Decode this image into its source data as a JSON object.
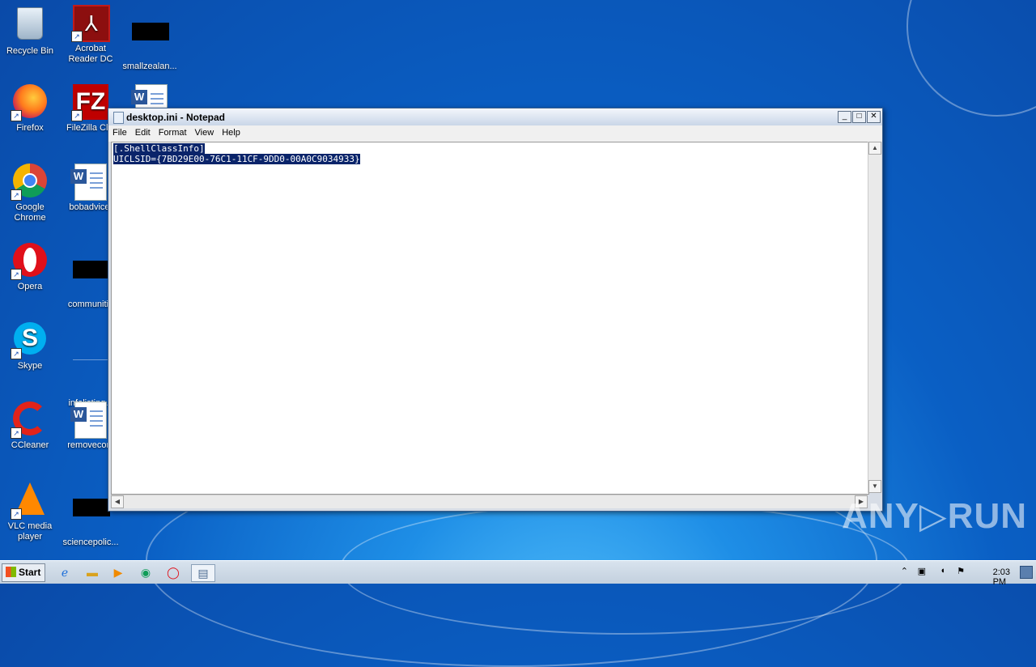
{
  "desktop": {
    "icons": [
      {
        "label": "Recycle Bin"
      },
      {
        "label": "Acrobat Reader DC"
      },
      {
        "label": "smallzealan..."
      },
      {
        "label": "Firefox"
      },
      {
        "label": "FileZilla Clie"
      },
      {
        "label": "Google Chrome"
      },
      {
        "label": "bobadvice."
      },
      {
        "label": "Opera"
      },
      {
        "label": "communitie"
      },
      {
        "label": "Skype"
      },
      {
        "label": "infolisting.p"
      },
      {
        "label": "CCleaner"
      },
      {
        "label": "removecont"
      },
      {
        "label": "VLC media player"
      },
      {
        "label": "sciencepolic..."
      }
    ]
  },
  "window": {
    "title": "desktop.ini - Notepad",
    "menu": [
      "File",
      "Edit",
      "Format",
      "View",
      "Help"
    ],
    "content_lines": [
      "[.ShellClassInfo]",
      "UICLSID={7BD29E00-76C1-11CF-9DD0-00A0C9034933}"
    ],
    "buttons": {
      "minimize": "_",
      "maximize": "□",
      "close": "✕"
    }
  },
  "taskbar": {
    "start_label": "Start",
    "clock": "2:03 PM"
  },
  "watermark": "ANY▷RUN"
}
